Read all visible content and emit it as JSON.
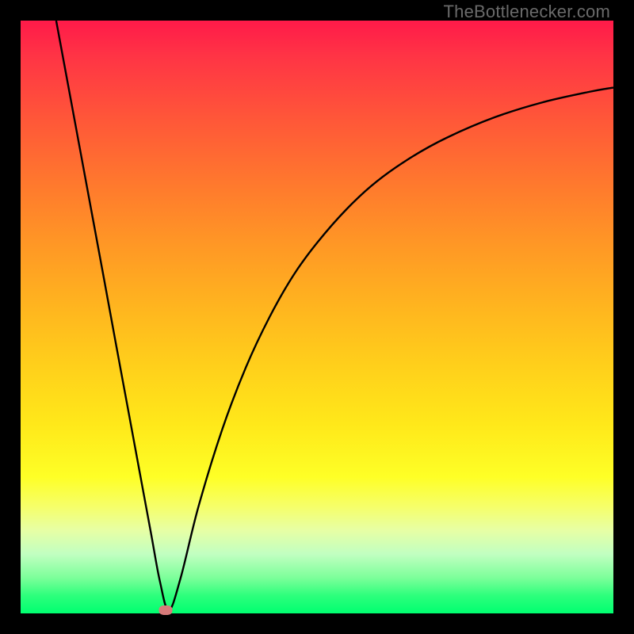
{
  "attribution": "TheBottlenecker.com",
  "colors": {
    "frame": "#000000",
    "curve": "#000000",
    "marker": "#d77a7a"
  },
  "chart_data": {
    "type": "line",
    "title": "",
    "xlabel": "",
    "ylabel": "",
    "xlim": [
      0,
      100
    ],
    "ylim": [
      0,
      100
    ],
    "series": [
      {
        "name": "bottleneck-curve",
        "x": [
          6,
          8,
          10,
          12,
          14,
          16,
          18,
          20,
          22,
          23.5,
          25,
          27,
          30,
          34,
          38,
          42,
          46,
          50,
          55,
          60,
          66,
          72,
          80,
          88,
          96,
          100
        ],
        "values": [
          100,
          89.2,
          78.4,
          67.6,
          56.8,
          45.9,
          35.1,
          24.3,
          13.5,
          5.4,
          0.5,
          6.0,
          18.0,
          31.0,
          41.5,
          50.0,
          57.0,
          62.5,
          68.2,
          72.8,
          77.0,
          80.3,
          83.7,
          86.2,
          88.0,
          88.7
        ]
      }
    ],
    "marker": {
      "x": 24.5,
      "y": 0.5
    },
    "gradient_stops": [
      {
        "pos": 0,
        "color": "#ff1a49"
      },
      {
        "pos": 50,
        "color": "#ffc21d"
      },
      {
        "pos": 80,
        "color": "#feff26"
      },
      {
        "pos": 100,
        "color": "#00ff70"
      }
    ]
  }
}
